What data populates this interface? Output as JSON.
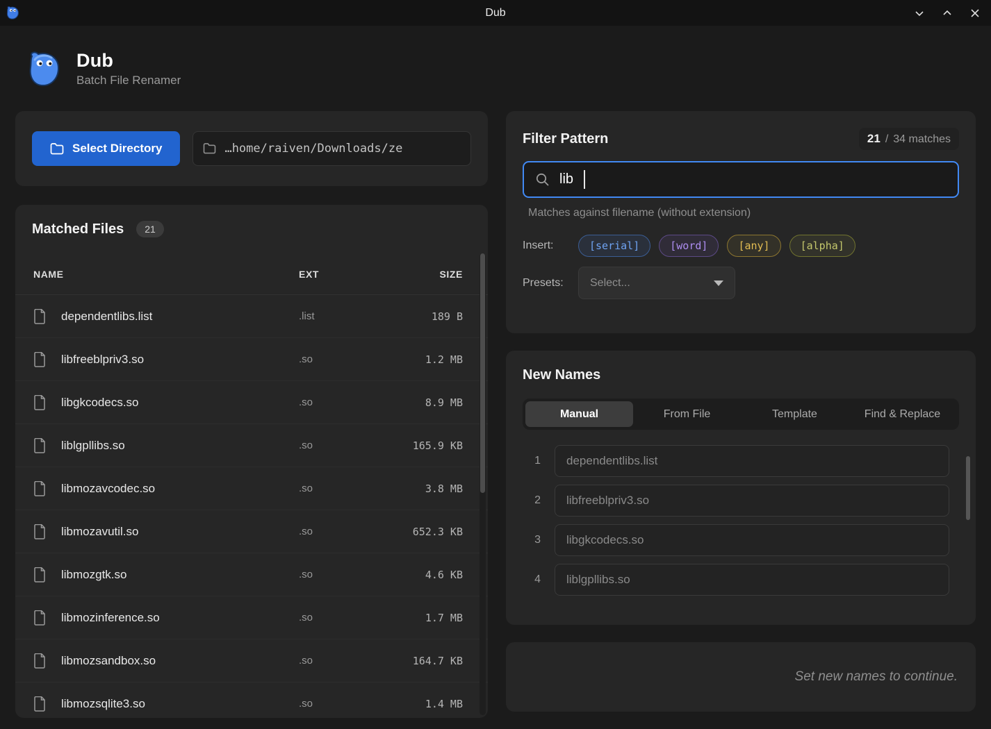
{
  "window": {
    "title": "Dub",
    "app_name": "Dub",
    "app_subtitle": "Batch File Renamer"
  },
  "colors": {
    "accent_blue": "#2264cf",
    "focus_border": "#4189f4"
  },
  "directory": {
    "select_button": "Select Directory",
    "path": "…home/raiven/Downloads/ze"
  },
  "matched_files": {
    "title": "Matched Files",
    "count": "21",
    "columns": [
      "NAME",
      "EXT",
      "SIZE"
    ],
    "rows": [
      {
        "name": "dependentlibs.list",
        "ext": ".list",
        "size": "189 B"
      },
      {
        "name": "libfreeblpriv3.so",
        "ext": ".so",
        "size": "1.2 MB"
      },
      {
        "name": "libgkcodecs.so",
        "ext": ".so",
        "size": "8.9 MB"
      },
      {
        "name": "liblgpllibs.so",
        "ext": ".so",
        "size": "165.9 KB"
      },
      {
        "name": "libmozavcodec.so",
        "ext": ".so",
        "size": "3.8 MB"
      },
      {
        "name": "libmozavutil.so",
        "ext": ".so",
        "size": "652.3 KB"
      },
      {
        "name": "libmozgtk.so",
        "ext": ".so",
        "size": "4.6 KB"
      },
      {
        "name": "libmozinference.so",
        "ext": ".so",
        "size": "1.7 MB"
      },
      {
        "name": "libmozsandbox.so",
        "ext": ".so",
        "size": "164.7 KB"
      },
      {
        "name": "libmozsqlite3.so",
        "ext": ".so",
        "size": "1.4 MB"
      }
    ]
  },
  "filter": {
    "title": "Filter Pattern",
    "matches_current": "21",
    "matches_separator": "/",
    "matches_total": "34 matches",
    "query": "lib",
    "hint": "Matches against filename (without extension)",
    "insert_label": "Insert:",
    "tokens": [
      {
        "label": "[serial]",
        "color": "#6fa3f2",
        "border": "#3b5d94",
        "background": "rgba(70,120,210,0.12)"
      },
      {
        "label": "[word]",
        "color": "#ad8df0",
        "border": "#5c4a86",
        "background": "rgba(140,100,220,0.10)"
      },
      {
        "label": "[any]",
        "color": "#e3bd53",
        "border": "#8d7630",
        "background": "rgba(210,175,70,0.08)"
      },
      {
        "label": "[alpha]",
        "color": "#c4c76c",
        "border": "#71742f",
        "background": "rgba(190,195,90,0.08)"
      }
    ],
    "presets_label": "Presets:",
    "presets_value": "Select..."
  },
  "new_names": {
    "title": "New Names",
    "tabs": [
      "Manual",
      "From File",
      "Template",
      "Find & Replace"
    ],
    "active_tab": "Manual",
    "entries": [
      {
        "index": "1",
        "value": "dependentlibs.list"
      },
      {
        "index": "2",
        "value": "libfreeblpriv3.so"
      },
      {
        "index": "3",
        "value": "libgkcodecs.so"
      },
      {
        "index": "4",
        "value": "liblgpllibs.so"
      }
    ]
  },
  "footer": {
    "message": "Set new names to continue."
  }
}
